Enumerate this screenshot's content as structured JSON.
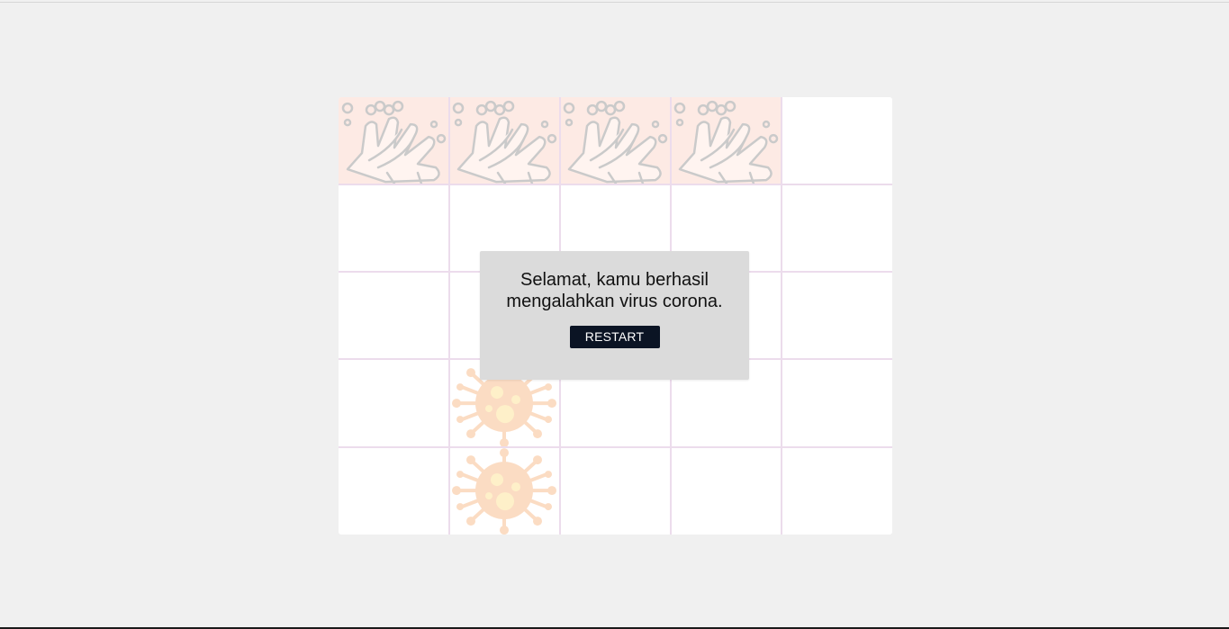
{
  "game": {
    "grid": {
      "rows": 5,
      "cols": 5
    },
    "hand_tiles": [
      {
        "row": 0,
        "col": 0,
        "icon": "handwash-icon"
      },
      {
        "row": 0,
        "col": 1,
        "icon": "handwash-icon"
      },
      {
        "row": 0,
        "col": 2,
        "icon": "handwash-icon"
      },
      {
        "row": 0,
        "col": 3,
        "icon": "handwash-icon"
      }
    ],
    "virus_tiles": [
      {
        "row": 3,
        "col": 1,
        "icon": "virus-icon"
      },
      {
        "row": 4,
        "col": 1,
        "icon": "virus-icon"
      }
    ],
    "colors": {
      "background": "#f0f0f0",
      "board": "#ffffff",
      "grid_line": "#ecdcec",
      "hand_tile": "#fde9e3",
      "virus": "#f7b27c",
      "virus_core": "#fde08a",
      "overlay": "#dbdbdb",
      "button": "#0b1424"
    }
  },
  "dialog": {
    "message": "Selamat, kamu berhasil mengalahkan virus corona.",
    "restart_label": "RESTART"
  }
}
